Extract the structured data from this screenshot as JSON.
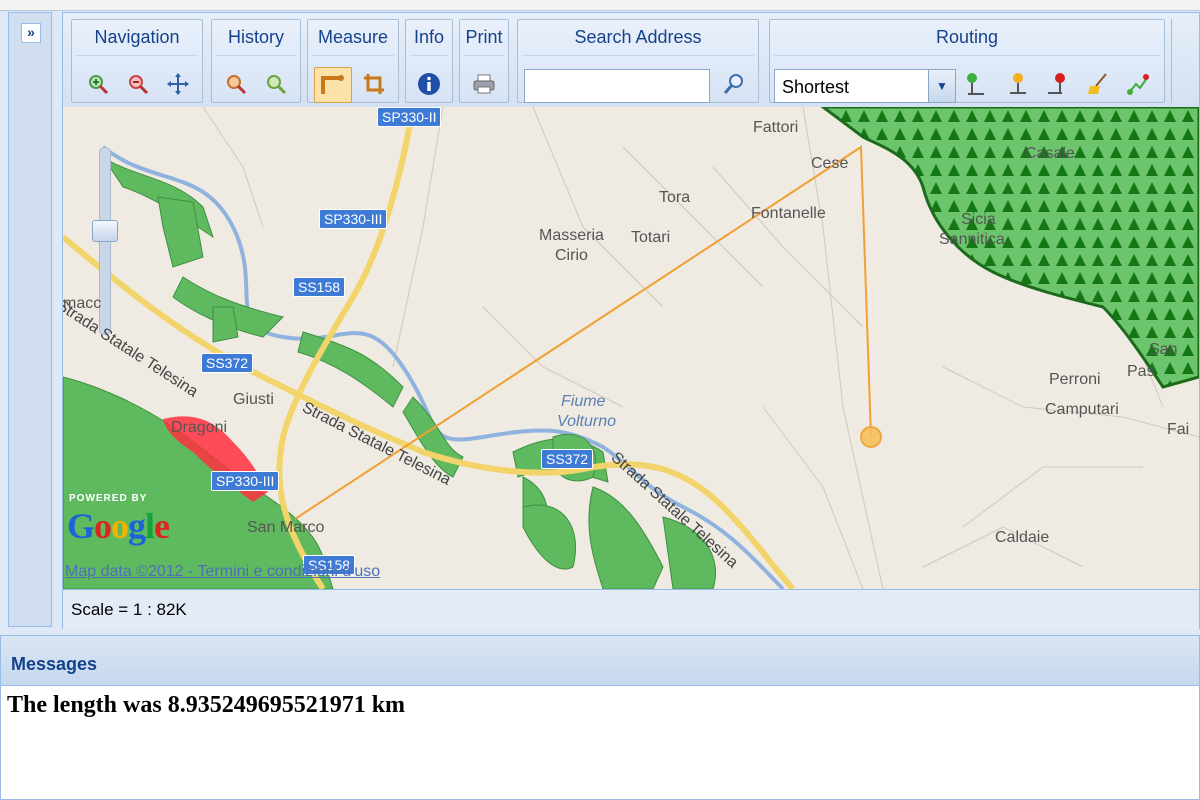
{
  "sidebar": {
    "expand_label": "»",
    "expand_icon": "double-chevron-right-icon"
  },
  "toolbar": {
    "groups": {
      "navigation": {
        "title": "Navigation",
        "buttons": [
          "zoom-in-icon",
          "zoom-out-icon",
          "pan-icon"
        ]
      },
      "history": {
        "title": "History",
        "buttons": [
          "zoom-previous-icon",
          "zoom-next-icon"
        ]
      },
      "measure": {
        "title": "Measure",
        "buttons": [
          "measure-line-icon",
          "measure-area-icon"
        ],
        "active": "measure-line-icon"
      },
      "info": {
        "title": "Info",
        "buttons": [
          "info-icon"
        ]
      },
      "print": {
        "title": "Print",
        "buttons": [
          "printer-icon"
        ]
      },
      "search": {
        "title": "Search Address",
        "value": "",
        "button": "magnifier-icon"
      },
      "routing": {
        "title": "Routing",
        "mode": "Shortest",
        "buttons": [
          "route-start-pin-icon",
          "route-via-pin-icon",
          "route-end-pin-icon",
          "broom-clear-icon",
          "route-compute-icon"
        ]
      }
    }
  },
  "map": {
    "labels": {
      "fattori": "Fattori",
      "cese": "Cese",
      "tora": "Tora",
      "fontanelle": "Fontanelle",
      "masseria": "Masseria",
      "cirio": "Cirio",
      "totari": "Totari",
      "casale": "Casale",
      "sicia": "Sicia",
      "sannitica": "Sannitica",
      "perroni": "Perroni",
      "camputari": "Camputari",
      "caldaie": "Caldaie",
      "fai": "Fai",
      "san": "San",
      "pas": "Pas",
      "giusti": "Giusti",
      "dragoni": "Dragoni",
      "san_marco": "San Marco",
      "fiume": "Fiume",
      "volturno": "Volturno",
      "macc": "macc",
      "strada_1": "Strada Statale Telesina",
      "strada_2": "Strada Statale Telesina",
      "strada_3": "Strada Statale Telesina"
    },
    "shields": {
      "sp330_ii": "SP330-II",
      "sp330_iii": "SP330-III",
      "ss158_a": "SS158",
      "ss372_a": "SS372",
      "ss372_b": "SS372",
      "sp330_iii_b": "SP330-III",
      "ss158_b": "SS158"
    },
    "powered_by": "POWERED BY",
    "google": "Google",
    "map_data": "Map data ©2012 - Termini e condizioni d'uso",
    "colors": {
      "measure_line": "#f0a030",
      "forest": "#1f8a1f",
      "forest_dark": "#136b13",
      "highlight": "#ff3040",
      "park_green": "#5cb85c",
      "road": "#f7e27a"
    }
  },
  "status": {
    "scale": "Scale = 1 : 82K"
  },
  "messages": {
    "title": "Messages",
    "text": "The length was 8.935249695521971 km",
    "length_km": 8.935249695521971
  }
}
